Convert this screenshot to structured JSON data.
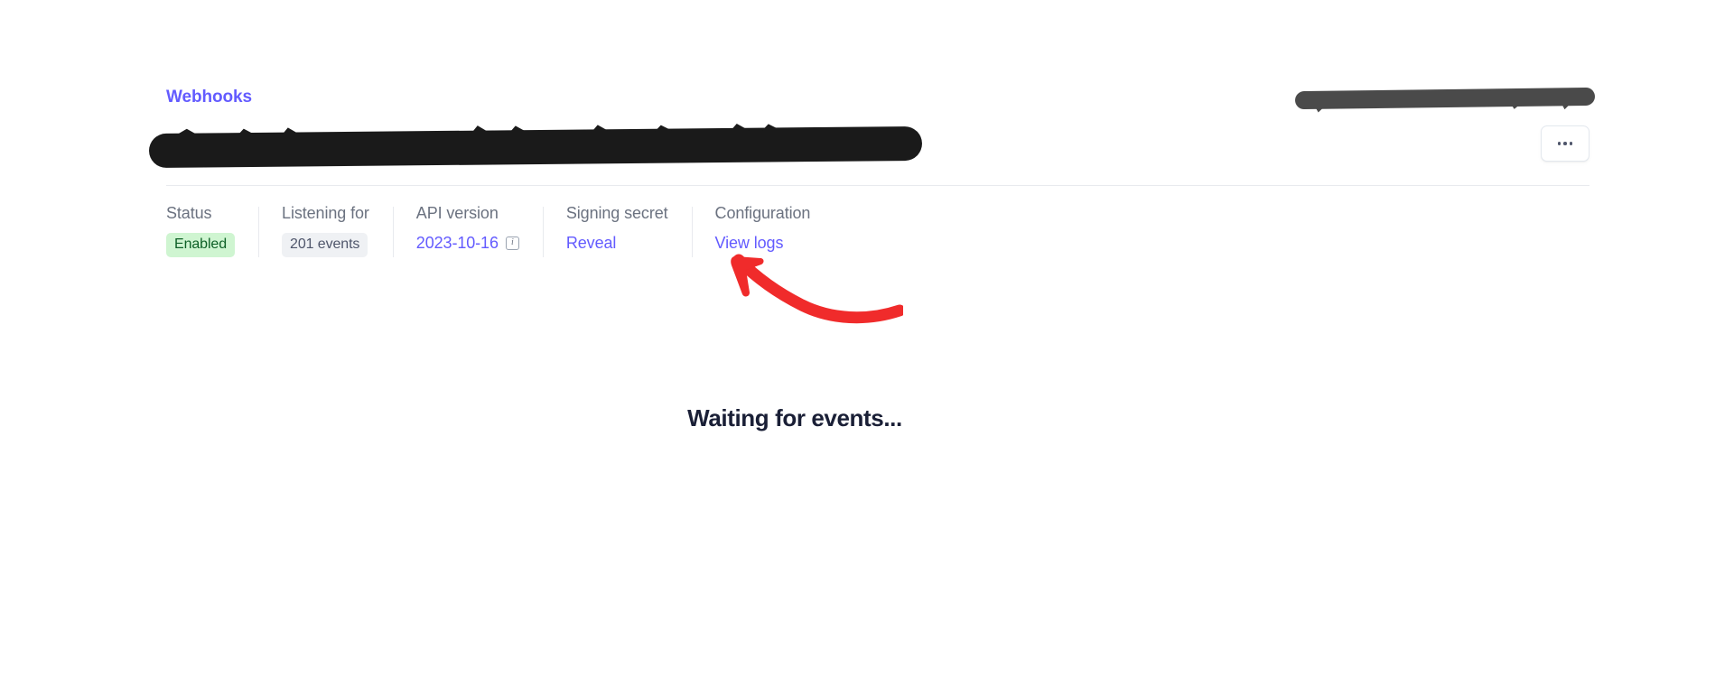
{
  "breadcrumb": {
    "label": "Webhooks"
  },
  "header": {
    "endpoint_url_redacted": true,
    "topright_label_redacted": true,
    "more_button_label": "…",
    "more_icon": "ellipsis-horizontal-icon"
  },
  "meta": {
    "columns": [
      {
        "label": "Status",
        "value": "Enabled",
        "style": "badge-enabled",
        "kind": "badge"
      },
      {
        "label": "Listening for",
        "value": "201 events",
        "style": "badge-neutral",
        "kind": "badge"
      },
      {
        "label": "API version",
        "value": "2023-10-16",
        "kind": "link-with-info",
        "info_icon": "info-icon",
        "info_glyph": "i"
      },
      {
        "label": "Signing secret",
        "value": "Reveal",
        "kind": "link"
      },
      {
        "label": "Configuration",
        "value": "View logs",
        "kind": "link"
      }
    ]
  },
  "main": {
    "empty_state_text": "Waiting for events..."
  },
  "annotation": {
    "type": "curved-arrow",
    "color": "#f02b2b",
    "points_to": "Reveal",
    "direction": "up-left"
  },
  "colors": {
    "brand_purple": "#635bff",
    "text_dark": "#1a1f36",
    "text_muted": "#6b7280",
    "badge_green_bg": "#cff5d1",
    "badge_green_text": "#0e6027",
    "badge_neutral_bg": "#eff1f4",
    "badge_neutral_text": "#4f566b",
    "divider": "#e8eaee",
    "annotation_red": "#f02b2b",
    "redaction_black": "#1a1a1a",
    "redaction_gray": "#4a4a4a"
  }
}
